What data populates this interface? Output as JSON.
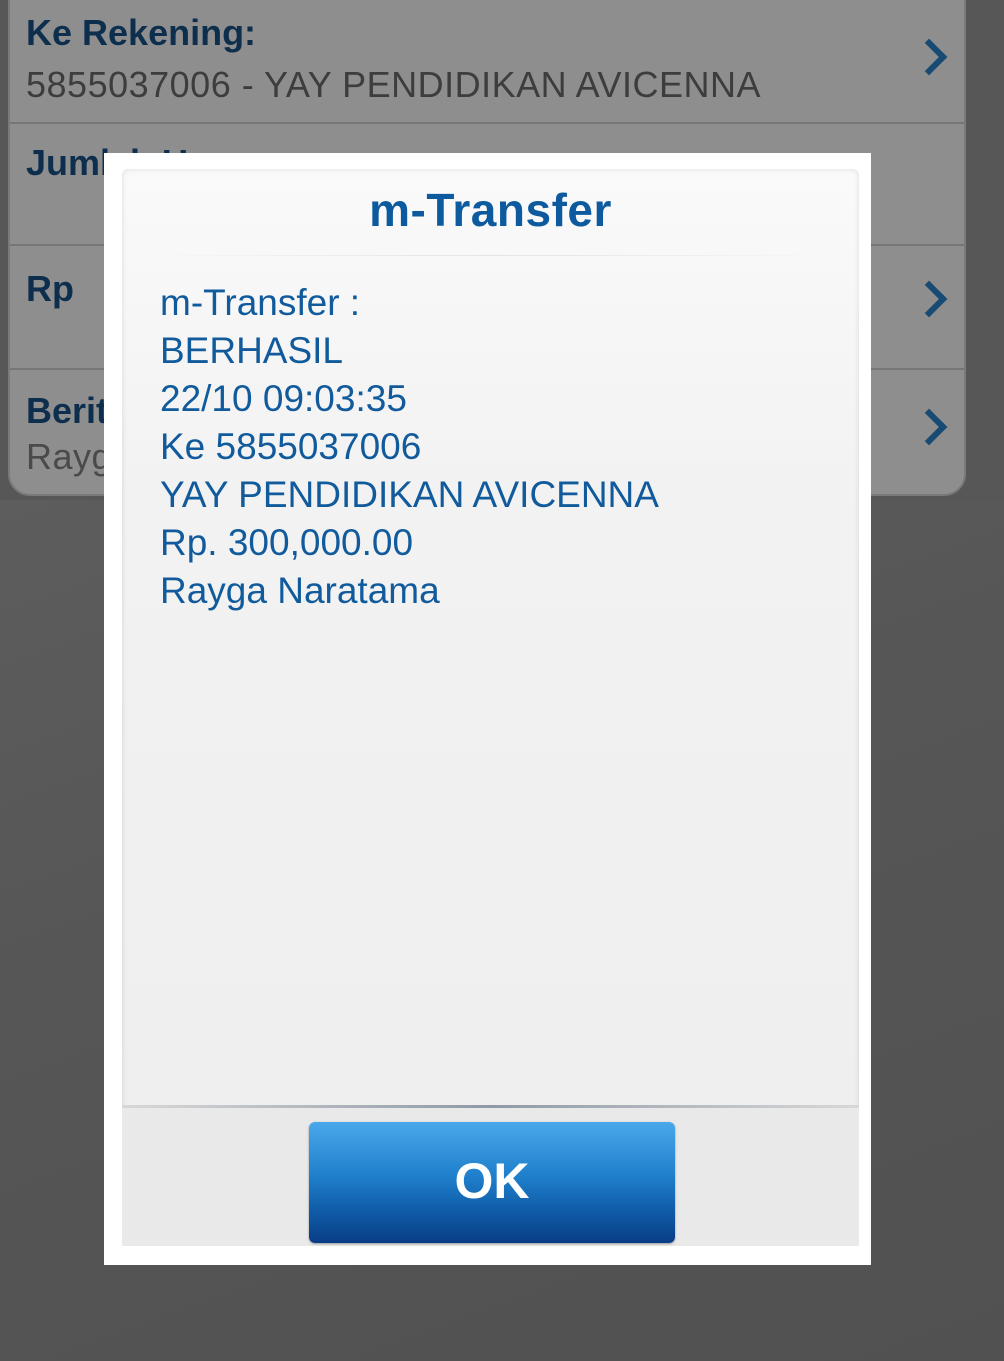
{
  "form": {
    "rows": [
      {
        "label": "Ke Rekening:",
        "value": "5855037006 - YAY PENDIDIKAN AVICENNA"
      },
      {
        "label": "Jumlah U",
        "value": ""
      },
      {
        "label": "Rp",
        "value": ""
      },
      {
        "label": "Berit",
        "value": "Rayg"
      }
    ]
  },
  "dialog": {
    "title": "m-Transfer",
    "message": [
      "m-Transfer :",
      "BERHASIL",
      "22/10 09:03:35",
      "Ke 5855037006",
      "YAY PENDIDIKAN AVICENNA",
      "Rp. 300,000.00",
      "Rayga Naratama"
    ],
    "ok_label": "OK"
  },
  "colors": {
    "accent": "#0d5b9e",
    "button_top": "#4aa8ea",
    "button_bottom": "#093d85",
    "overlay": "#575757"
  }
}
